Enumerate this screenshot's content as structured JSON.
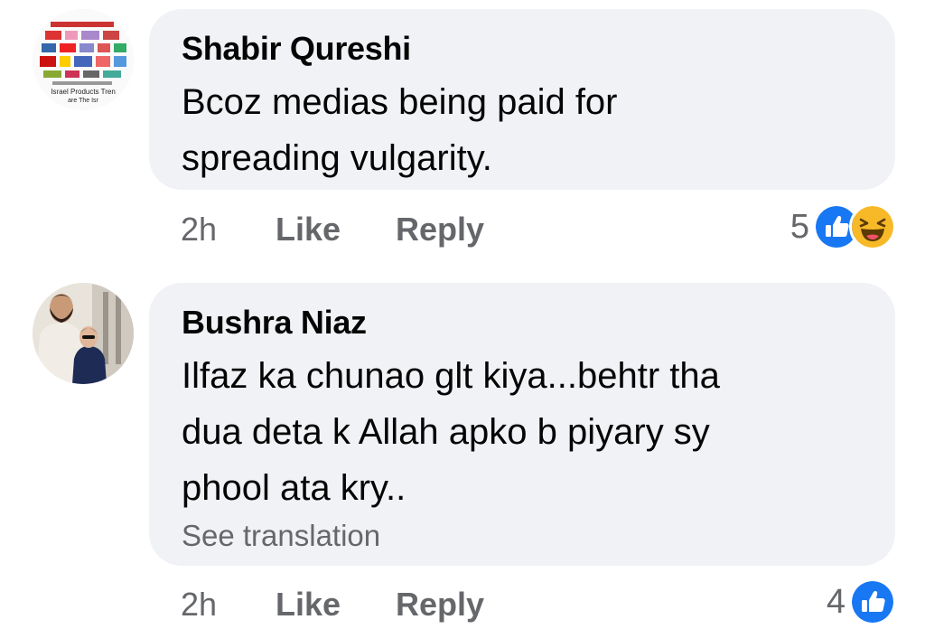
{
  "comments": [
    {
      "author": "Shabir Qureshi",
      "text_lines": [
        "Bcoz medias being paid for",
        "spreading vulgarity."
      ],
      "avatar_text": [
        "Israel Products Tren",
        "are The Isr"
      ],
      "time": "2h",
      "like_label": "Like",
      "reply_label": "Reply",
      "reaction_count": "5",
      "reactions": [
        "like-icon",
        "haha-icon"
      ]
    },
    {
      "author": "Bushra Niaz",
      "text_lines": [
        "Ilfaz ka chunao glt kiya...behtr tha",
        "dua deta k Allah apko b piyary sy",
        "phool ata kry.."
      ],
      "see_translation": "See translation",
      "time": "2h",
      "like_label": "Like",
      "reply_label": "Reply",
      "reaction_count": "4",
      "reactions": [
        "like-icon"
      ]
    }
  ],
  "colors": {
    "bubble": "#f0f2f5",
    "meta": "#65676b",
    "like_blue": "#1877f2",
    "haha_yellow": "#f7b928"
  }
}
